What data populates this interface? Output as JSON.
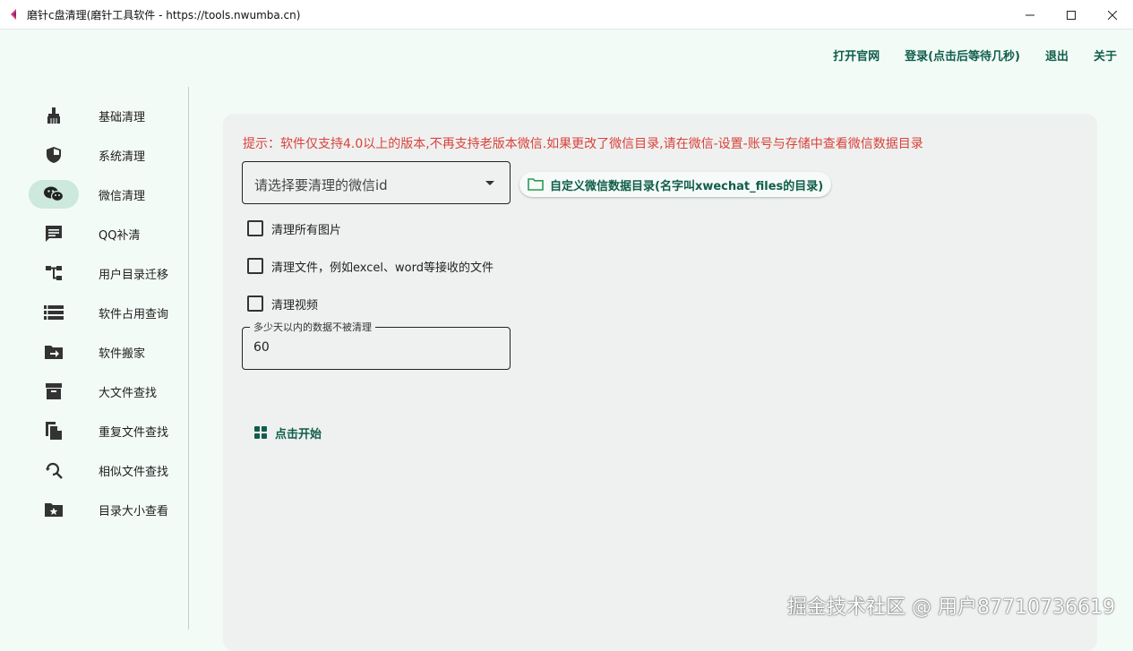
{
  "window": {
    "title": "磨针c盘清理(磨针工具软件 - https://tools.nwumba.cn)",
    "icons": {
      "minimize": "minimize-icon",
      "maximize": "maximize-icon",
      "close": "close-icon"
    }
  },
  "topnav": [
    "打开官网",
    "登录(点击后等待几秒)",
    "退出",
    "关于"
  ],
  "sidebar": {
    "active_index": 2,
    "items": [
      {
        "label": "基础清理",
        "icon": "broom-icon"
      },
      {
        "label": "系统清理",
        "icon": "shield-icon"
      },
      {
        "label": "微信清理",
        "icon": "wechat-icon"
      },
      {
        "label": "QQ补清",
        "icon": "chat-icon"
      },
      {
        "label": "用户目录迁移",
        "icon": "tree-icon"
      },
      {
        "label": "软件占用查询",
        "icon": "list-icon"
      },
      {
        "label": "软件搬家",
        "icon": "folder-move-icon"
      },
      {
        "label": "大文件查找",
        "icon": "archive-icon"
      },
      {
        "label": "重复文件查找",
        "icon": "copy-icon"
      },
      {
        "label": "相似文件查找",
        "icon": "search-refresh-icon"
      },
      {
        "label": "目录大小查看",
        "icon": "folder-star-icon"
      }
    ]
  },
  "main": {
    "hint": "提示：软件仅支持4.0以上的版本,不再支持老版本微信.如果更改了微信目录,请在微信-设置-账号与存储中查看微信数据目录",
    "select_placeholder": "请选择要清理的微信id",
    "custom_dir_button": "自定义微信数据目录(名字叫xwechat_files的目录)",
    "checkboxes": [
      {
        "label": "清理所有图片",
        "checked": false
      },
      {
        "label": "清理文件，例如excel、word等接收的文件",
        "checked": false
      },
      {
        "label": "清理视频",
        "checked": false
      }
    ],
    "days_field": {
      "label": "多少天以内的数据不被清理",
      "value": "60"
    },
    "start_button": "点击开始"
  },
  "watermark": "掘金技术社区 @ 用户87710736619",
  "colors": {
    "accent": "#0f5e4a",
    "hint": "#d9423b",
    "active_pill": "#cde8dc",
    "panel": "#eff1f0",
    "background": "#f3fbf7"
  }
}
